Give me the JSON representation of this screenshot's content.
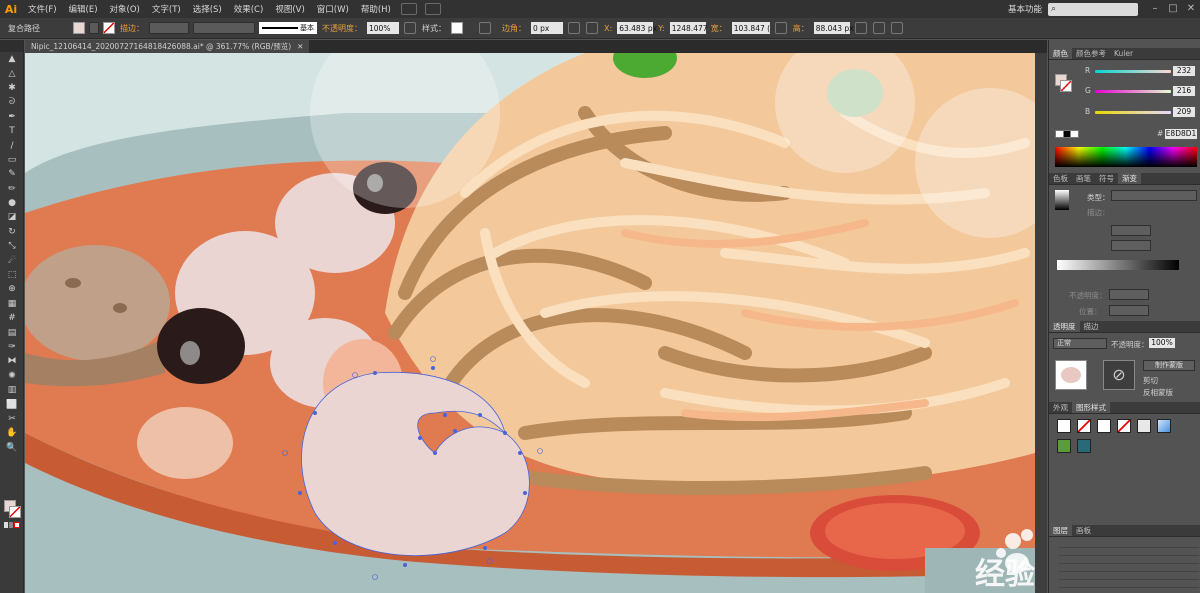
{
  "menu": {
    "logo": "Ai",
    "items": [
      "文件(F)",
      "编辑(E)",
      "对象(O)",
      "文字(T)",
      "选择(S)",
      "效果(C)",
      "视图(V)",
      "窗口(W)",
      "帮助(H)"
    ],
    "workspace": "基本功能",
    "search_icon": "search-icon",
    "window_buttons": [
      "–",
      "□",
      "✕"
    ]
  },
  "control_bar": {
    "path_label": "复合路径",
    "stroke_label": "描边：",
    "stroke_style": "基本",
    "opacity_label": "不透明度：",
    "opacity_value": "100%",
    "style_label": "样式：",
    "corner_label": "边角：",
    "corner_value": "0 px",
    "x_label": "X:",
    "x_value": "63.483 px",
    "y_label": "Y:",
    "y_value": "1248.477",
    "w_label": "宽：",
    "w_value": "103.847 (",
    "h_label": "高：",
    "h_value": "88.043 px"
  },
  "document": {
    "tab_title": "Nipic_12106414_20200727164818426088.ai* @ 361.77% (RGB/预览)"
  },
  "tools": {
    "icons": [
      "selection-icon",
      "direct-selection-icon",
      "magic-wand-icon",
      "lasso-icon",
      "pen-icon",
      "type-icon",
      "line-icon",
      "rectangle-icon",
      "paintbrush-icon",
      "pencil-icon",
      "blob-brush-icon",
      "eraser-icon",
      "rotate-icon",
      "scale-icon",
      "warp-icon",
      "free-transform-icon",
      "shape-builder-icon",
      "perspective-icon",
      "mesh-icon",
      "gradient-icon",
      "eyedropper-icon",
      "blend-icon",
      "symbol-sprayer-icon",
      "graph-icon",
      "artboard-icon",
      "slice-icon",
      "hand-icon",
      "zoom-icon"
    ],
    "glyphs": [
      "▲",
      "△",
      "✱",
      "ᘐ",
      "✒",
      "T",
      "/",
      "▭",
      "✎",
      "✏",
      "●",
      "◪",
      "↻",
      "⤡",
      "☄",
      "⬚",
      "⊕",
      "▦",
      "#",
      "▤",
      "✑",
      "⧓",
      "✺",
      "▥",
      "⬜",
      "✂",
      "✋",
      "🔍"
    ]
  },
  "color_panel": {
    "tabs": [
      "颜色",
      "颜色参考",
      "Kuler"
    ],
    "r_label": "R",
    "r_value": "232",
    "g_label": "G",
    "g_value": "216",
    "b_label": "B",
    "b_value": "209",
    "hex_label": "#",
    "hex_value": "E8D8D1"
  },
  "swatch_panel": {
    "tabs": [
      "色板",
      "画笔",
      "符号",
      "渐变"
    ],
    "type_label": "类型：",
    "stroke_label": "描边：",
    "opacity_label": "不透明度：",
    "position_label": "位置："
  },
  "transparency_panel": {
    "tabs": [
      "透明度",
      "描边"
    ],
    "mode": "正常",
    "opacity_label": "不透明度：",
    "opacity_value": "100%",
    "make_mask": "制作蒙版",
    "clip": "剪切",
    "invert_mask": "反相蒙版"
  },
  "graphic_styles_panel": {
    "tabs": [
      "外观",
      "图形样式"
    ]
  },
  "layers_panel": {
    "tabs": [
      "图层",
      "画板"
    ]
  },
  "watermark": "经验",
  "colors": {
    "accent": "#e8a13a",
    "canvas_bg": "#d4e4e2",
    "plate": "#a8bfbf",
    "sauce": "#e07a50",
    "noodle_dark": "#b98a5a",
    "noodle_light": "#f2cfa6",
    "shrimp": "#e8d8d1",
    "olive": "#2a1a1a",
    "selection": "#4a64d8"
  }
}
